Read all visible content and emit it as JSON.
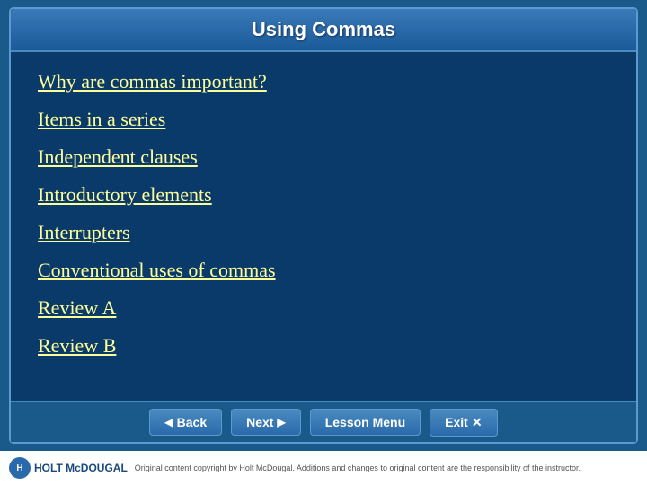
{
  "title": "Using Commas",
  "menu_items": [
    {
      "label": "Why are commas important?",
      "id": "why-commas"
    },
    {
      "label": "Items in a series",
      "id": "items-series"
    },
    {
      "label": "Independent clauses",
      "id": "independent-clauses"
    },
    {
      "label": "Introductory elements",
      "id": "introductory-elements"
    },
    {
      "label": "Interrupters",
      "id": "interrupters"
    },
    {
      "label": "Conventional uses of commas",
      "id": "conventional-uses"
    },
    {
      "label": "Review A",
      "id": "review-a"
    },
    {
      "label": "Review B",
      "id": "review-b"
    }
  ],
  "buttons": {
    "back": "Back",
    "next": "Next",
    "lesson_menu": "Lesson Menu",
    "exit": "Exit"
  },
  "footer": {
    "logo_name": "HOLT McDOUGAL",
    "copyright": "Original content copyright by Holt McDougal. Additions and changes to original content are the responsibility of the instructor."
  }
}
